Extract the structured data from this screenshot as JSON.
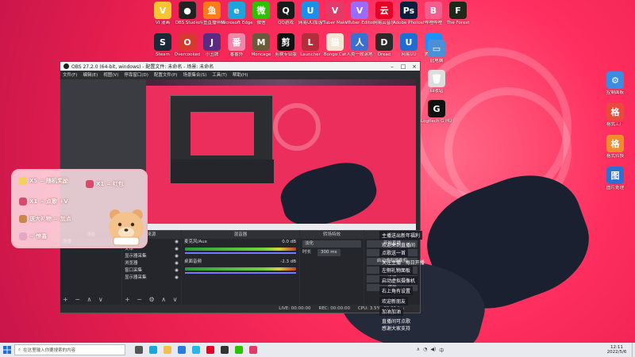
{
  "desktop": {
    "top_icons": [
      {
        "label": "VI 漫画",
        "color": "#f7c531",
        "glyph": "V"
      },
      {
        "label": "OBS Studio",
        "color": "#222222",
        "glyph": "●"
      },
      {
        "label": "斗鱼直播伴侣",
        "color": "#ff7b1a",
        "glyph": "鱼"
      },
      {
        "label": "Microsoft Edge",
        "color": "#1ea4db",
        "glyph": "e"
      },
      {
        "label": "微信",
        "color": "#2dc100",
        "glyph": "微"
      },
      {
        "label": "QQ游戏",
        "color": "#1a1a1a",
        "glyph": "Q"
      },
      {
        "label": "网易UU加速",
        "color": "#1c8fe8",
        "glyph": "U"
      },
      {
        "label": "VTuber Maker",
        "color": "#e23b6a",
        "glyph": "V"
      },
      {
        "label": "VTuber Editor",
        "color": "#9b6bff",
        "glyph": "V"
      },
      {
        "label": "网易云音乐",
        "color": "#e60026",
        "glyph": "云"
      },
      {
        "label": "Adobe Photoshop",
        "color": "#0a1f3d",
        "glyph": "Ps"
      },
      {
        "label": "哔哩哔哩",
        "color": "#f25d8e",
        "glyph": "B"
      },
      {
        "label": "The Forest",
        "color": "#1d2a1a",
        "glyph": "F"
      }
    ],
    "second_row_icons": [
      {
        "label": "Steam",
        "color": "#1b2838",
        "glyph": "S"
      },
      {
        "label": "Overcooked",
        "color": "#d63a2f",
        "glyph": "O"
      },
      {
        "label": "小丑牌",
        "color": "#5a2b82",
        "glyph": "J"
      },
      {
        "label": "番番外",
        "color": "#e8a",
        "glyph": "番"
      },
      {
        "label": "Moncage",
        "color": "#6b5a3a",
        "glyph": "M"
      },
      {
        "label": "剪映专业版",
        "color": "#111111",
        "glyph": "剪"
      },
      {
        "label": "Launcher",
        "color": "#b52c3a",
        "glyph": "L"
      },
      {
        "label": "Bongo Cat",
        "color": "#f0e6d2",
        "glyph": "猫"
      },
      {
        "label": "人类一败涂地",
        "color": "#3b6fd0",
        "glyph": "人"
      },
      {
        "label": "Dread",
        "color": "#2a2a2a",
        "glyph": "D"
      },
      {
        "label": "网易UU",
        "color": "#1e6ed1",
        "glyph": "U"
      },
      {
        "label": "腾讯视频",
        "color": "#1d8ffd",
        "glyph": "▶"
      }
    ],
    "right_icons": [
      {
        "label": "此电脑",
        "color": "#4a90d9",
        "glyph": "▭"
      },
      {
        "label": "回收站",
        "color": "#dddddd",
        "glyph": "🗑"
      },
      {
        "label": "Logitech G HUB",
        "color": "#111111",
        "glyph": "G"
      }
    ],
    "far_right_icons": [
      {
        "label": "控制面板",
        "color": "#3d8be0",
        "glyph": "⚙"
      },
      {
        "label": "格式工厂",
        "color": "#e84b3a",
        "glyph": "格"
      },
      {
        "label": "格式转换",
        "color": "#f08a2b",
        "glyph": "格"
      },
      {
        "label": "图片处理",
        "color": "#2f6fd0",
        "glyph": "图"
      }
    ]
  },
  "obs": {
    "title": "OBS 27.2.0 (64-bit, windows) - 配置文件: 未命名 - 场景: 未命名",
    "menu": [
      "文件(F)",
      "编辑(E)",
      "视图(V)",
      "停靠窗口(D)",
      "配置文件(P)",
      "场景集合(S)",
      "工具(T)",
      "帮助(H)"
    ],
    "docks": {
      "scenes_title": "场景",
      "scene_item": "场景",
      "sources_title": "来源",
      "sources": [
        "图像",
        "文本",
        "显示器采集",
        "浏览器",
        "窗口采集",
        "显示器采集"
      ],
      "mixer_title": "混音器",
      "mixer_channels": [
        {
          "name": "麦克风/Aux",
          "db": "0.0 dB"
        },
        {
          "name": "桌面音频",
          "db": "-2.3 dB"
        }
      ],
      "transitions_title": "转场特效",
      "transition": "淡化",
      "duration_label": "时长",
      "duration_value": "300 ms",
      "controls_title": "控件",
      "controls": [
        "开始直播",
        "开始录制",
        "启动虚拟摄像机",
        "工作室模式",
        "设置",
        "退出"
      ]
    },
    "status": {
      "live": "LIVE: 00:00:00",
      "rec": "REC: 00:00:00",
      "cpu": "CPU: 3.5%, 30.00 fps"
    }
  },
  "overlay": {
    "items": [
      {
        "text": "X5 = 随机奖励",
        "color": "#f5d15a"
      },
      {
        "text": "X1 = 红包",
        "color": "#d54b6a"
      },
      {
        "text": "X1 = 点歌 +V",
        "color": "#d54b6a"
      },
      {
        "text": "送大礼物 = 加点",
        "color": "#c9874a"
      },
      {
        "text": "= 惊喜",
        "color": "#e4a8c2"
      }
    ]
  },
  "chat": {
    "lines": [
      {
        "text": "主播送出新年福利",
        "dark": true
      },
      {
        "text": "欢迎来到直播间",
        "dark": false
      },
      {
        "text": "点歌送一首",
        "dark": true
      },
      {
        "text": "关注主播 · 每日开播",
        "dark": false
      },
      {
        "text": "左侧礼物面板",
        "dark": true
      },
      {
        "text": "启动虚拟摄像机",
        "dark": true
      },
      {
        "text": "右上角有设置",
        "dark": true
      },
      {
        "text": "欢迎新朋友",
        "dark": true
      },
      {
        "text": "加油加油",
        "dark": true
      },
      {
        "text": "直播间可点歌",
        "dark": false
      },
      {
        "text": "感谢大家支持",
        "dark": false
      }
    ]
  },
  "taskbar": {
    "search_placeholder": "在这里输入你要搜索的内容",
    "time": "12:11",
    "date": "2022/5/6",
    "apps": [
      {
        "name": "task-view",
        "color": "#555555"
      },
      {
        "name": "edge",
        "color": "#1ea4db"
      },
      {
        "name": "explorer",
        "color": "#f2c04d"
      },
      {
        "name": "store",
        "color": "#2b7bd8"
      },
      {
        "name": "bilibili",
        "color": "#25b9e8"
      },
      {
        "name": "netease",
        "color": "#e60026"
      },
      {
        "name": "obs",
        "color": "#333333"
      },
      {
        "name": "wechat",
        "color": "#2dc100"
      },
      {
        "name": "capture",
        "color": "#e23b6a"
      }
    ]
  }
}
